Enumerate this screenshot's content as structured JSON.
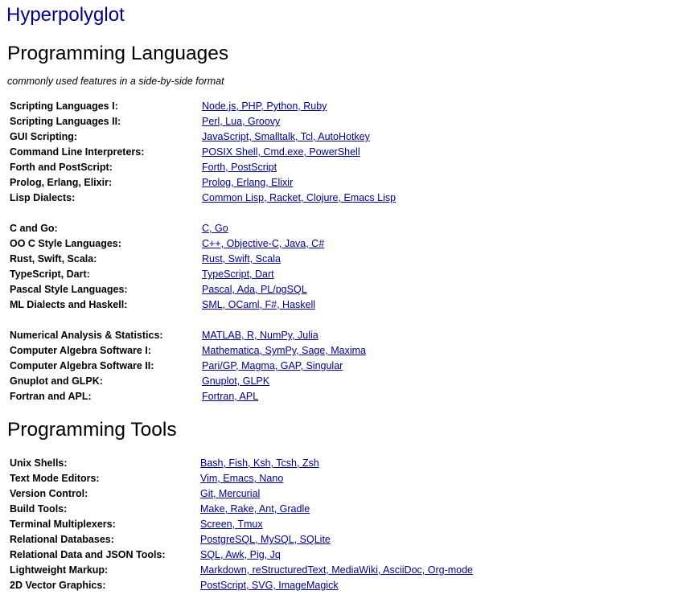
{
  "site_title": "Hyperpolyglot",
  "sections": [
    {
      "heading": "Programming Languages",
      "subtitle": "commonly used features in a side-by-side format",
      "groups": [
        [
          {
            "label": "Scripting Languages I:",
            "links": "Node.js, PHP, Python, Ruby"
          },
          {
            "label": "Scripting Languages II:",
            "links": "Perl, Lua, Groovy"
          },
          {
            "label": "GUI Scripting:",
            "links": "JavaScript, Smalltalk, Tcl, AutoHotkey"
          },
          {
            "label": "Command Line Interpreters:",
            "links": "POSIX Shell, Cmd.exe, PowerShell"
          },
          {
            "label": "Forth and PostScript:",
            "links": "Forth, PostScript"
          },
          {
            "label": "Prolog, Erlang, Elixir:",
            "links": "Prolog, Erlang, Elixir"
          },
          {
            "label": "Lisp Dialects:",
            "links": "Common Lisp, Racket, Clojure, Emacs Lisp"
          }
        ],
        [
          {
            "label": "C and Go:",
            "links": "C, Go"
          },
          {
            "label": "OO C Style Languages:",
            "links": "C++, Objective-C, Java, C#"
          },
          {
            "label": "Rust, Swift, Scala:",
            "links": "Rust, Swift, Scala"
          },
          {
            "label": "TypeScript, Dart:",
            "links": "TypeScript, Dart"
          },
          {
            "label": "Pascal Style Languages:",
            "links": "Pascal, Ada, PL/pgSQL"
          },
          {
            "label": "ML Dialects and Haskell:",
            "links": "SML, OCaml, F#, Haskell"
          }
        ],
        [
          {
            "label": "Numerical Analysis & Statistics:",
            "links": "MATLAB, R, NumPy, Julia"
          },
          {
            "label": "Computer Algebra Software I:",
            "links": "Mathematica, SymPy, Sage, Maxima"
          },
          {
            "label": "Computer Algebra Software II:",
            "links": "Pari/GP, Magma, GAP, Singular"
          },
          {
            "label": "Gnuplot and GLPK:",
            "links": "Gnuplot, GLPK"
          },
          {
            "label": "Fortran and APL:",
            "links": "Fortran, APL"
          }
        ]
      ]
    },
    {
      "heading": "Programming Tools",
      "groups": [
        [
          {
            "label": "Unix Shells:",
            "links": "Bash, Fish, Ksh, Tcsh, Zsh"
          },
          {
            "label": "Text Mode Editors:",
            "links": "Vim, Emacs, Nano"
          },
          {
            "label": "Version Control:",
            "links": "Git, Mercurial"
          },
          {
            "label": "Build Tools:",
            "links": "Make, Rake, Ant, Gradle"
          },
          {
            "label": "Terminal Multiplexers:",
            "links": "Screen, Tmux"
          },
          {
            "label": "Relational Databases:",
            "links": "PostgreSQL, MySQL, SQLite"
          },
          {
            "label": "Relational Data and JSON Tools:",
            "links": "SQL, Awk, Pig, Jq"
          },
          {
            "label": "Lightweight Markup:",
            "links": "Markdown, reStructuredText, MediaWiki, AsciiDoc, Org-mode"
          },
          {
            "label": "2D Vector Graphics:",
            "links": "PostScript, SVG, ImageMagick"
          }
        ]
      ]
    }
  ]
}
